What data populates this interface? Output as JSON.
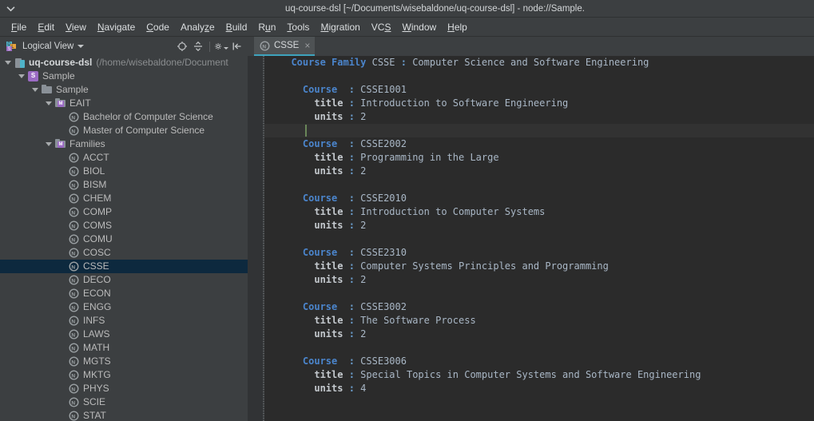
{
  "window": {
    "title": "uq-course-dsl [~/Documents/wisebaldone/uq-course-dsl] - node://Sample.",
    "chevron_icon": "chevron-down-icon"
  },
  "menubar": {
    "items": [
      {
        "label": "File",
        "mnemonic": "F"
      },
      {
        "label": "Edit",
        "mnemonic": "E"
      },
      {
        "label": "View",
        "mnemonic": "V"
      },
      {
        "label": "Navigate",
        "mnemonic": "N"
      },
      {
        "label": "Code",
        "mnemonic": "C"
      },
      {
        "label": "Analyze",
        "mnemonic": "z"
      },
      {
        "label": "Build",
        "mnemonic": "B"
      },
      {
        "label": "Run",
        "mnemonic": "u"
      },
      {
        "label": "Tools",
        "mnemonic": "T"
      },
      {
        "label": "Migration",
        "mnemonic": "M"
      },
      {
        "label": "VCS",
        "mnemonic": "S"
      },
      {
        "label": "Window",
        "mnemonic": "W"
      },
      {
        "label": "Help",
        "mnemonic": "H"
      }
    ]
  },
  "project_toolbar": {
    "view_label": "Logical View",
    "view_icon": "logical-view-icon",
    "caret_icon": "chevron-down-icon",
    "actions": [
      {
        "name": "locate-in-tree-icon",
        "glyph": "⊕"
      },
      {
        "name": "collapse-all-icon",
        "glyph": "÷"
      },
      {
        "name": "settings-gear-icon",
        "glyph": "⚙"
      },
      {
        "name": "hide-panel-icon",
        "glyph": "⇥"
      }
    ]
  },
  "editor_tabs": [
    {
      "label": "CSSE",
      "icon": "node-icon",
      "close_icon": "close-icon",
      "active": true
    }
  ],
  "tree": [
    {
      "depth": 0,
      "label": "uq-course-dsl",
      "sub": "(/home/wisebaldone/Document",
      "icon": "project-icon",
      "arrow": true,
      "bold": true,
      "selected": false
    },
    {
      "depth": 1,
      "label": "Sample",
      "sub": "",
      "icon": "module-icon",
      "arrow": true,
      "bold": false,
      "selected": false
    },
    {
      "depth": 2,
      "label": "Sample",
      "sub": "",
      "icon": "folder-icon",
      "arrow": true,
      "bold": false,
      "selected": false
    },
    {
      "depth": 3,
      "label": "EAIT",
      "sub": "",
      "icon": "folder-model-icon",
      "arrow": true,
      "bold": false,
      "selected": false
    },
    {
      "depth": 4,
      "label": "Bachelor of Computer Science",
      "sub": "",
      "icon": "node-icon",
      "arrow": false,
      "bold": false,
      "selected": false
    },
    {
      "depth": 4,
      "label": "Master of Computer Science",
      "sub": "",
      "icon": "node-icon",
      "arrow": false,
      "bold": false,
      "selected": false
    },
    {
      "depth": 3,
      "label": "Families",
      "sub": "",
      "icon": "folder-model-icon",
      "arrow": true,
      "bold": false,
      "selected": false
    },
    {
      "depth": 4,
      "label": "ACCT",
      "sub": "",
      "icon": "node-icon",
      "arrow": false,
      "bold": false,
      "selected": false
    },
    {
      "depth": 4,
      "label": "BIOL",
      "sub": "",
      "icon": "node-icon",
      "arrow": false,
      "bold": false,
      "selected": false
    },
    {
      "depth": 4,
      "label": "BISM",
      "sub": "",
      "icon": "node-icon",
      "arrow": false,
      "bold": false,
      "selected": false
    },
    {
      "depth": 4,
      "label": "CHEM",
      "sub": "",
      "icon": "node-icon",
      "arrow": false,
      "bold": false,
      "selected": false
    },
    {
      "depth": 4,
      "label": "COMP",
      "sub": "",
      "icon": "node-icon",
      "arrow": false,
      "bold": false,
      "selected": false
    },
    {
      "depth": 4,
      "label": "COMS",
      "sub": "",
      "icon": "node-icon",
      "arrow": false,
      "bold": false,
      "selected": false
    },
    {
      "depth": 4,
      "label": "COMU",
      "sub": "",
      "icon": "node-icon",
      "arrow": false,
      "bold": false,
      "selected": false
    },
    {
      "depth": 4,
      "label": "COSC",
      "sub": "",
      "icon": "node-icon",
      "arrow": false,
      "bold": false,
      "selected": false
    },
    {
      "depth": 4,
      "label": "CSSE",
      "sub": "",
      "icon": "node-icon",
      "arrow": false,
      "bold": false,
      "selected": true
    },
    {
      "depth": 4,
      "label": "DECO",
      "sub": "",
      "icon": "node-icon",
      "arrow": false,
      "bold": false,
      "selected": false
    },
    {
      "depth": 4,
      "label": "ECON",
      "sub": "",
      "icon": "node-icon",
      "arrow": false,
      "bold": false,
      "selected": false
    },
    {
      "depth": 4,
      "label": "ENGG",
      "sub": "",
      "icon": "node-icon",
      "arrow": false,
      "bold": false,
      "selected": false
    },
    {
      "depth": 4,
      "label": "INFS",
      "sub": "",
      "icon": "node-icon",
      "arrow": false,
      "bold": false,
      "selected": false
    },
    {
      "depth": 4,
      "label": "LAWS",
      "sub": "",
      "icon": "node-icon",
      "arrow": false,
      "bold": false,
      "selected": false
    },
    {
      "depth": 4,
      "label": "MATH",
      "sub": "",
      "icon": "node-icon",
      "arrow": false,
      "bold": false,
      "selected": false
    },
    {
      "depth": 4,
      "label": "MGTS",
      "sub": "",
      "icon": "node-icon",
      "arrow": false,
      "bold": false,
      "selected": false
    },
    {
      "depth": 4,
      "label": "MKTG",
      "sub": "",
      "icon": "node-icon",
      "arrow": false,
      "bold": false,
      "selected": false
    },
    {
      "depth": 4,
      "label": "PHYS",
      "sub": "",
      "icon": "node-icon",
      "arrow": false,
      "bold": false,
      "selected": false
    },
    {
      "depth": 4,
      "label": "SCIE",
      "sub": "",
      "icon": "node-icon",
      "arrow": false,
      "bold": false,
      "selected": false
    },
    {
      "depth": 4,
      "label": "STAT",
      "sub": "",
      "icon": "node-icon",
      "arrow": false,
      "bold": false,
      "selected": false
    }
  ],
  "editor": {
    "lines": [
      {
        "indent": 1,
        "segments": [
          {
            "t": "Course Family",
            "c": "kw"
          },
          {
            "t": " CSSE ",
            "c": "val"
          },
          {
            "t": ":",
            "c": "pun"
          },
          {
            "t": " Computer Science and Software Engineering",
            "c": "val"
          }
        ]
      },
      {
        "indent": 0,
        "segments": []
      },
      {
        "indent": 2,
        "segments": [
          {
            "t": "Course",
            "c": "kw"
          },
          {
            "t": "  ",
            "c": "val"
          },
          {
            "t": ":",
            "c": "pun"
          },
          {
            "t": " CSSE1001",
            "c": "val"
          }
        ]
      },
      {
        "indent": 3,
        "segments": [
          {
            "t": "title",
            "c": "attr"
          },
          {
            "t": " ",
            "c": "val"
          },
          {
            "t": ":",
            "c": "pun"
          },
          {
            "t": " Introduction to Software Engineering",
            "c": "val"
          }
        ]
      },
      {
        "indent": 3,
        "segments": [
          {
            "t": "units",
            "c": "attr"
          },
          {
            "t": " ",
            "c": "val"
          },
          {
            "t": ":",
            "c": "pun"
          },
          {
            "t": " 2",
            "c": "val"
          }
        ]
      },
      {
        "indent": 0,
        "caret": true,
        "segments": []
      },
      {
        "indent": 2,
        "segments": [
          {
            "t": "Course",
            "c": "kw"
          },
          {
            "t": "  ",
            "c": "val"
          },
          {
            "t": ":",
            "c": "pun"
          },
          {
            "t": " CSSE2002",
            "c": "val"
          }
        ]
      },
      {
        "indent": 3,
        "segments": [
          {
            "t": "title",
            "c": "attr"
          },
          {
            "t": " ",
            "c": "val"
          },
          {
            "t": ":",
            "c": "pun"
          },
          {
            "t": " Programming in the Large",
            "c": "val"
          }
        ]
      },
      {
        "indent": 3,
        "segments": [
          {
            "t": "units",
            "c": "attr"
          },
          {
            "t": " ",
            "c": "val"
          },
          {
            "t": ":",
            "c": "pun"
          },
          {
            "t": " 2",
            "c": "val"
          }
        ]
      },
      {
        "indent": 0,
        "segments": []
      },
      {
        "indent": 2,
        "segments": [
          {
            "t": "Course",
            "c": "kw"
          },
          {
            "t": "  ",
            "c": "val"
          },
          {
            "t": ":",
            "c": "pun"
          },
          {
            "t": " CSSE2010",
            "c": "val"
          }
        ]
      },
      {
        "indent": 3,
        "segments": [
          {
            "t": "title",
            "c": "attr"
          },
          {
            "t": " ",
            "c": "val"
          },
          {
            "t": ":",
            "c": "pun"
          },
          {
            "t": " Introduction to Computer Systems",
            "c": "val"
          }
        ]
      },
      {
        "indent": 3,
        "segments": [
          {
            "t": "units",
            "c": "attr"
          },
          {
            "t": " ",
            "c": "val"
          },
          {
            "t": ":",
            "c": "pun"
          },
          {
            "t": " 2",
            "c": "val"
          }
        ]
      },
      {
        "indent": 0,
        "segments": []
      },
      {
        "indent": 2,
        "segments": [
          {
            "t": "Course",
            "c": "kw"
          },
          {
            "t": "  ",
            "c": "val"
          },
          {
            "t": ":",
            "c": "pun"
          },
          {
            "t": " CSSE2310",
            "c": "val"
          }
        ]
      },
      {
        "indent": 3,
        "segments": [
          {
            "t": "title",
            "c": "attr"
          },
          {
            "t": " ",
            "c": "val"
          },
          {
            "t": ":",
            "c": "pun"
          },
          {
            "t": " Computer Systems Principles and Programming",
            "c": "val"
          }
        ]
      },
      {
        "indent": 3,
        "segments": [
          {
            "t": "units",
            "c": "attr"
          },
          {
            "t": " ",
            "c": "val"
          },
          {
            "t": ":",
            "c": "pun"
          },
          {
            "t": " 2",
            "c": "val"
          }
        ]
      },
      {
        "indent": 0,
        "segments": []
      },
      {
        "indent": 2,
        "segments": [
          {
            "t": "Course",
            "c": "kw"
          },
          {
            "t": "  ",
            "c": "val"
          },
          {
            "t": ":",
            "c": "pun"
          },
          {
            "t": " CSSE3002",
            "c": "val"
          }
        ]
      },
      {
        "indent": 3,
        "segments": [
          {
            "t": "title",
            "c": "attr"
          },
          {
            "t": " ",
            "c": "val"
          },
          {
            "t": ":",
            "c": "pun"
          },
          {
            "t": " The Software Process",
            "c": "val"
          }
        ]
      },
      {
        "indent": 3,
        "segments": [
          {
            "t": "units",
            "c": "attr"
          },
          {
            "t": " ",
            "c": "val"
          },
          {
            "t": ":",
            "c": "pun"
          },
          {
            "t": " 2",
            "c": "val"
          }
        ]
      },
      {
        "indent": 0,
        "segments": []
      },
      {
        "indent": 2,
        "segments": [
          {
            "t": "Course",
            "c": "kw"
          },
          {
            "t": "  ",
            "c": "val"
          },
          {
            "t": ":",
            "c": "pun"
          },
          {
            "t": " CSSE3006",
            "c": "val"
          }
        ]
      },
      {
        "indent": 3,
        "segments": [
          {
            "t": "title",
            "c": "attr"
          },
          {
            "t": " ",
            "c": "val"
          },
          {
            "t": ":",
            "c": "pun"
          },
          {
            "t": " Special Topics in Computer Systems and Software Engineering",
            "c": "val"
          }
        ]
      },
      {
        "indent": 3,
        "segments": [
          {
            "t": "units",
            "c": "attr"
          },
          {
            "t": " ",
            "c": "val"
          },
          {
            "t": ":",
            "c": "pun"
          },
          {
            "t": " 4",
            "c": "val"
          }
        ]
      }
    ]
  },
  "colors": {
    "window_bg": "#3c3f41",
    "editor_bg": "#2b2b2b",
    "selection": "#0d293e",
    "keyword": "#4b85cc",
    "tab_underline": "#3ea3bd",
    "caret": "#6a8759"
  }
}
